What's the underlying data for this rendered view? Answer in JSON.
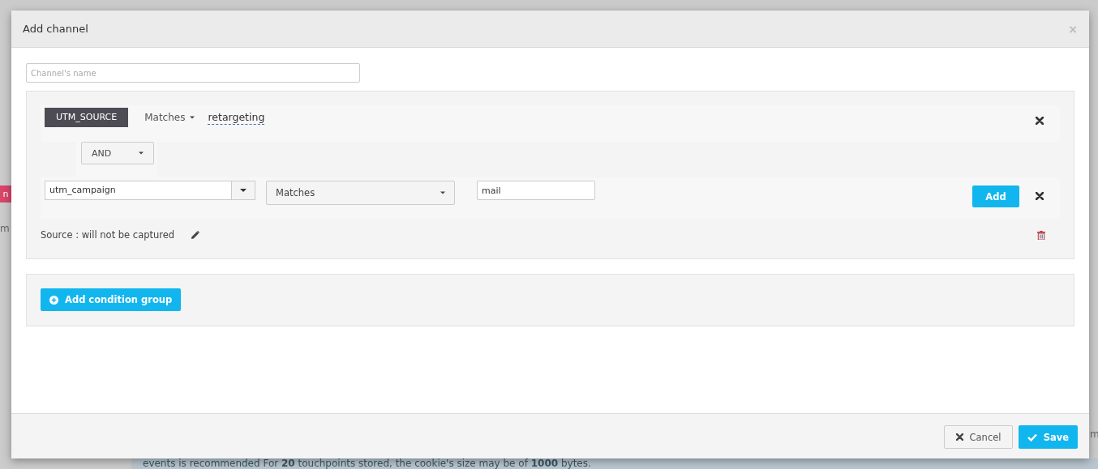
{
  "background": {
    "tag": "n",
    "left_text": "m",
    "notice": "events is recommended For **20** touchpoints stored, the cookie's size may be of **1000** bytes.",
    "right_text": "m"
  },
  "dialog": {
    "title": "Add channel",
    "close": "×"
  },
  "name_field": {
    "placeholder": "Channel's name"
  },
  "condition_group": {
    "conditions": [
      {
        "kind": "saved",
        "field": "UTM_SOURCE",
        "operator": "Matches",
        "value": "retargeting"
      },
      {
        "kind": "editing",
        "field": "utm_campaign",
        "operator": "Matches",
        "value": "mail",
        "add_button": "Add"
      }
    ],
    "connector": "AND",
    "source_note": "Source : will not be captured"
  },
  "add_group_button": "Add condition group",
  "footer": {
    "cancel": "Cancel",
    "save": "Save"
  }
}
